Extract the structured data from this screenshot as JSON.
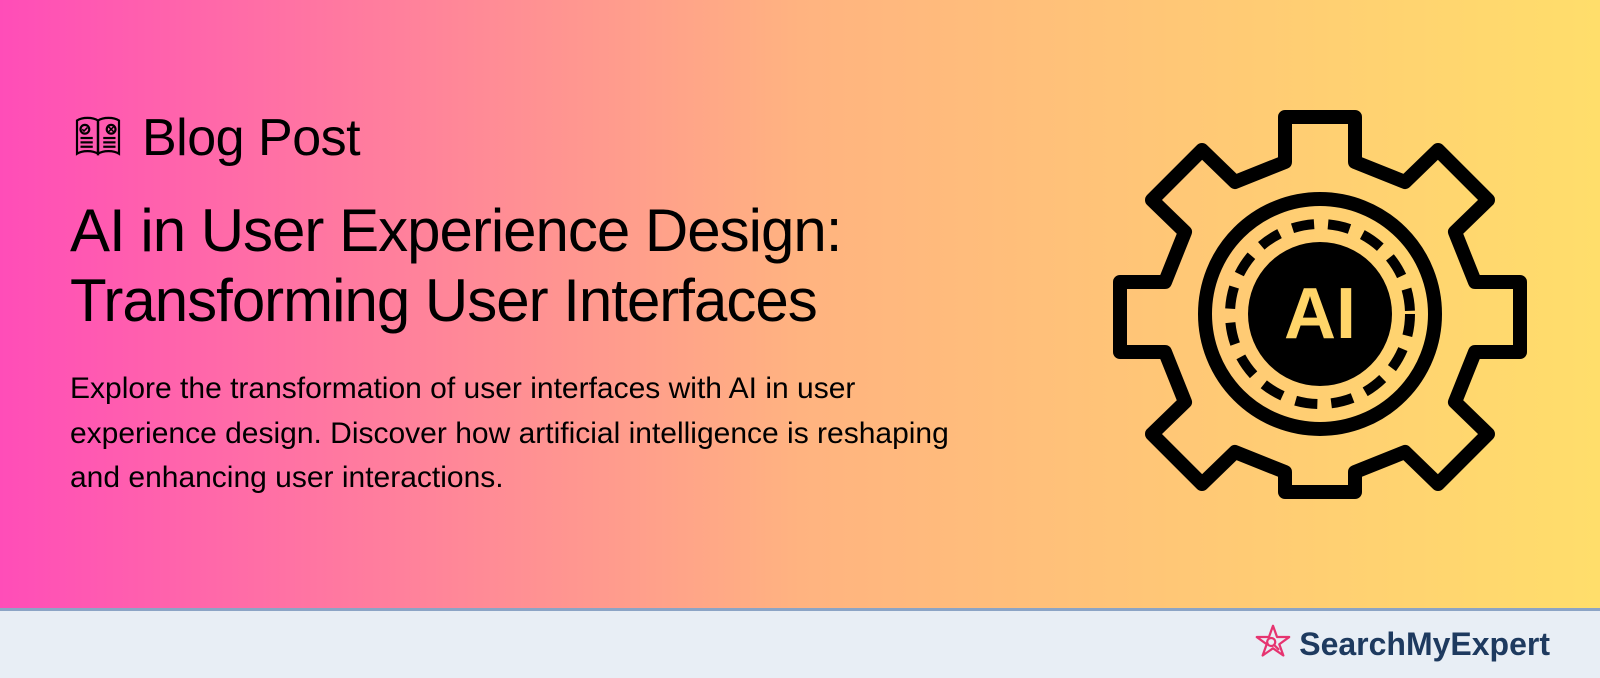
{
  "category": {
    "label": "Blog Post"
  },
  "title": "AI in User Experience Design: Transforming User Interfaces",
  "description": "Explore the transformation of user interfaces with AI in user experience design. Discover how artificial intelligence is reshaping and enhancing user interactions.",
  "gear": {
    "centerText": "AI"
  },
  "footer": {
    "logoText": "SearchMyExpert"
  },
  "colors": {
    "gradientStart": "#ff4db8",
    "gradientMid": "#ffb380",
    "gradientEnd": "#ffde6b",
    "textPrimary": "#000000",
    "footerBg": "#e8eef5",
    "footerBorder": "#8ca4c5",
    "logoColor": "#1e3a5f",
    "starColor": "#e63470"
  }
}
